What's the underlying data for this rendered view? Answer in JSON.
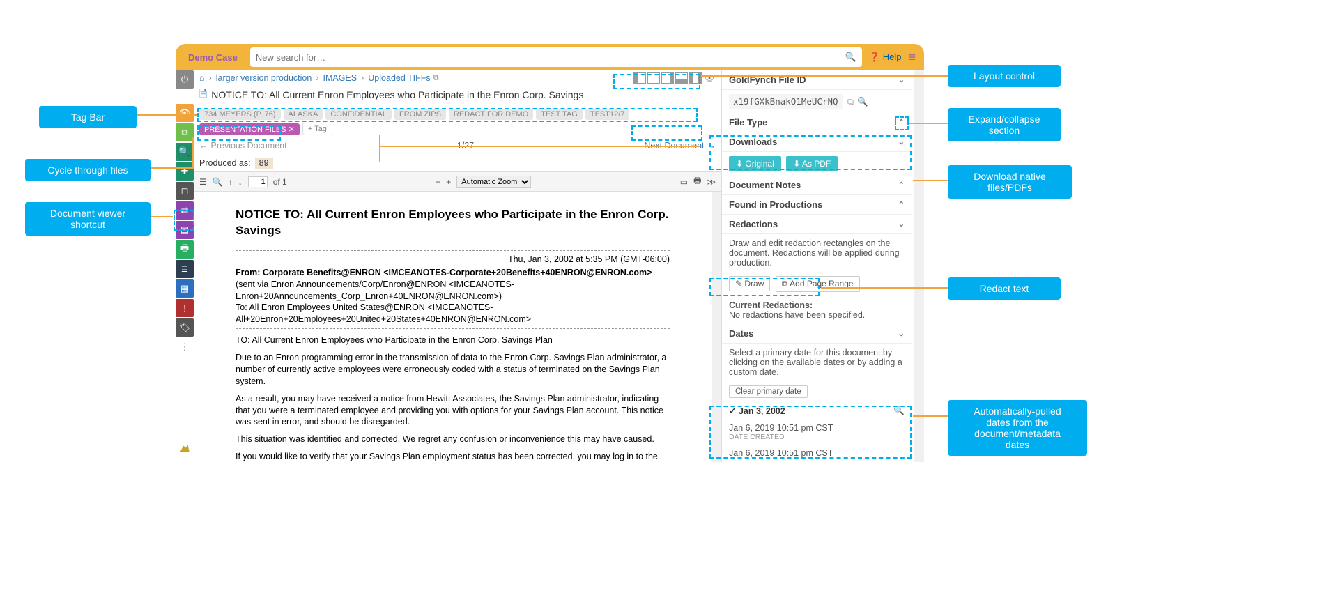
{
  "topbar": {
    "case_name": "Demo Case",
    "search_placeholder": "New search for…",
    "help_label": "Help"
  },
  "breadcrumb": {
    "items": [
      "larger version production",
      "IMAGES",
      "Uploaded TIFFs"
    ]
  },
  "doc_title": "NOTICE TO: All Current Enron Employees who Participate in the Enron Corp. Savings",
  "tags": {
    "items": [
      "734 MEYERS (P.  76)",
      "ALASKA",
      "CONFIDENTIAL",
      "FROM ZIPS",
      "REDACT FOR DEMO",
      "TEST TAG",
      "TEST12/7"
    ],
    "active": "PRESENTATION FILES ✕",
    "add": "+ Tag"
  },
  "nav": {
    "prev": "Previous Document",
    "indicator": "1/27",
    "next": "Next Document"
  },
  "produced": {
    "label": "Produced as:",
    "value": "89"
  },
  "pdftb": {
    "page": "1",
    "of": "of 1",
    "zoom": "Automatic Zoom"
  },
  "document": {
    "heading": "NOTICE TO: All Current Enron Employees who Participate in the Enron Corp. Savings",
    "dateline": "Thu, Jan 3, 2002 at 5:35 PM (GMT-06:00)",
    "from_label": "From: Corporate Benefits@ENRON <IMCEANOTES-Corporate+20Benefits+40ENRON@ENRON.com>",
    "from_cont": " (sent via Enron Announcements/Corp/Enron@ENRON <IMCEANOTES-Enron+20Announcements_Corp_Enron+40ENRON@ENRON.com>)",
    "to": "To: All Enron Employees United States@ENRON <IMCEANOTES-All+20Enron+20Employees+20United+20States+40ENRON@ENRON.com>",
    "p1": "TO:  All Current Enron Employees who Participate in the Enron Corp. Savings Plan",
    "p2": "Due to an Enron programming error in the transmission of data to the Enron Corp. Savings Plan administrator, a number of currently active employees were erroneously coded with a status of terminated on the Savings Plan system.",
    "p3": "As a result, you may have received a notice from Hewitt Associates, the Savings Plan administrator, indicating that you were a terminated employee and providing you with options for your Savings Plan account.  This notice was sent in error, and should be disregarded.",
    "p4": "This situation was identified and corrected.  We regret any confusion or inconvenience this may have caused.",
    "p5": "If you would like to verify that your Savings Plan employment status has been corrected, you may log in to the Savings Plan website through the Enron intranet (benefits.enron.com) or the internet (resources.hewitt.com/enron) and view your status in the \"Personal Data\" option off the main log-in screen."
  },
  "right": {
    "id_label": "GoldFynch File ID",
    "id_value": "x19fGXkBnakO1MeUCrNQ",
    "filetype_label": "File Type",
    "downloads_label": "Downloads",
    "btn_original": "Original",
    "btn_pdf": "As PDF",
    "notes_label": "Document Notes",
    "found_label": "Found in Productions",
    "redactions_label": "Redactions",
    "redactions_help": "Draw and edit redaction rectangles on the document. Redactions will be applied during production.",
    "btn_draw": "Draw",
    "btn_range": "Add Page Range",
    "current_label": "Current Redactions:",
    "current_text": "No redactions have been specified.",
    "dates_label": "Dates",
    "dates_help": "Select a primary date for this document by clicking on the available dates or by adding a custom date.",
    "btn_clear": "Clear primary date",
    "date1": "Jan 3, 2002",
    "date2": "Jan 6, 2019 10:51 pm CST",
    "date2_sub": "DATE CREATED",
    "date3": "Jan 6, 2019 10:51 pm CST"
  },
  "callouts": {
    "tagbar": "Tag Bar",
    "cycle": "Cycle through files",
    "shortcut": "Document viewer\nshortcut",
    "layout": "Layout control",
    "expand": "Expand/collapse\nsection",
    "download": "Download native\nfiles/PDFs",
    "redact": "Redact text",
    "dates": "Automatically-pulled\ndates from the\ndocument/metadata\ndates"
  }
}
